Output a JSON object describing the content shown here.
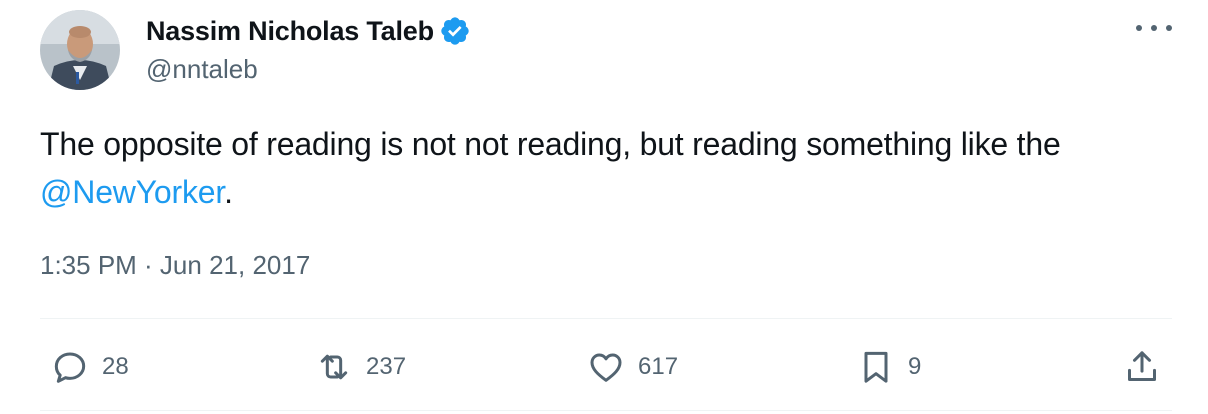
{
  "author": {
    "name": "Nassim Nicholas Taleb",
    "handle": "@nntaleb",
    "verified": true
  },
  "tweet": {
    "text_before": "The opposite of reading is not not reading, but reading something like the ",
    "mention": "@NewYorker",
    "text_after": ".",
    "timestamp": "1:35 PM · Jun 21, 2017"
  },
  "actions": {
    "replies": "28",
    "retweets": "237",
    "likes": "617",
    "bookmarks": "9"
  },
  "colors": {
    "accent": "#1d9bf0",
    "text": "#0f1419",
    "muted": "#536471",
    "divider": "#eff3f4"
  },
  "icons": {
    "more": "more-horizontal-icon",
    "reply": "reply-icon",
    "retweet": "retweet-icon",
    "like": "heart-icon",
    "bookmark": "bookmark-icon",
    "share": "share-icon",
    "verified": "verified-badge-icon"
  }
}
